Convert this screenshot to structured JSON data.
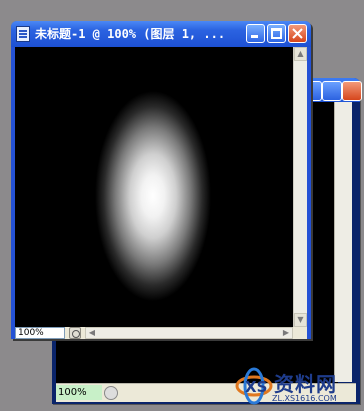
{
  "front_window": {
    "title": "未标题-1 @ 100% (图层 1, ...",
    "zoom": "100%",
    "scroll_up": "▲",
    "scroll_down": "▼",
    "scroll_left": "◀",
    "scroll_right": "▶"
  },
  "back_window": {
    "zoom": "100%"
  },
  "watermark": {
    "name": "资料网",
    "url": "ZL.XS1616.COM"
  },
  "colors": {
    "titlebar": "#2b63e1",
    "canvas": "#000000",
    "glow": "#ffffff",
    "desktop": "#8c8a8c"
  }
}
